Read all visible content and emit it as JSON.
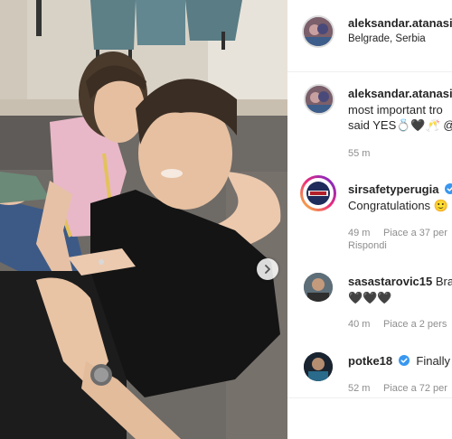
{
  "post": {
    "username": "aleksandar.atanasi",
    "location": "Belgrade, Serbia"
  },
  "caption": {
    "username": "aleksandar.atanasi",
    "line1": "most important tro",
    "line2": "said YES💍🖤🥂 @e",
    "time": "55 m"
  },
  "comments": [
    {
      "username": "sirsafetyperugia",
      "verified": true,
      "line1": "Congratulations 🙂",
      "time": "49 m",
      "likes": "Piace a 37 per",
      "reply": "Rispondi"
    },
    {
      "username": "sasastarovic15",
      "verified": false,
      "text_inline": "Bra",
      "line1": "🖤🖤🖤",
      "time": "40 m",
      "likes": "Piace a 2 pers"
    },
    {
      "username": "potke18",
      "verified": true,
      "text_inline": "Finally",
      "time": "52 m",
      "likes": "Piace a 72 per"
    }
  ],
  "colors": {
    "verified": "#3897f0",
    "story_ring": "#d6249f"
  },
  "icons": [
    "chevron-right-icon",
    "verified-badge-icon",
    "avatar"
  ]
}
